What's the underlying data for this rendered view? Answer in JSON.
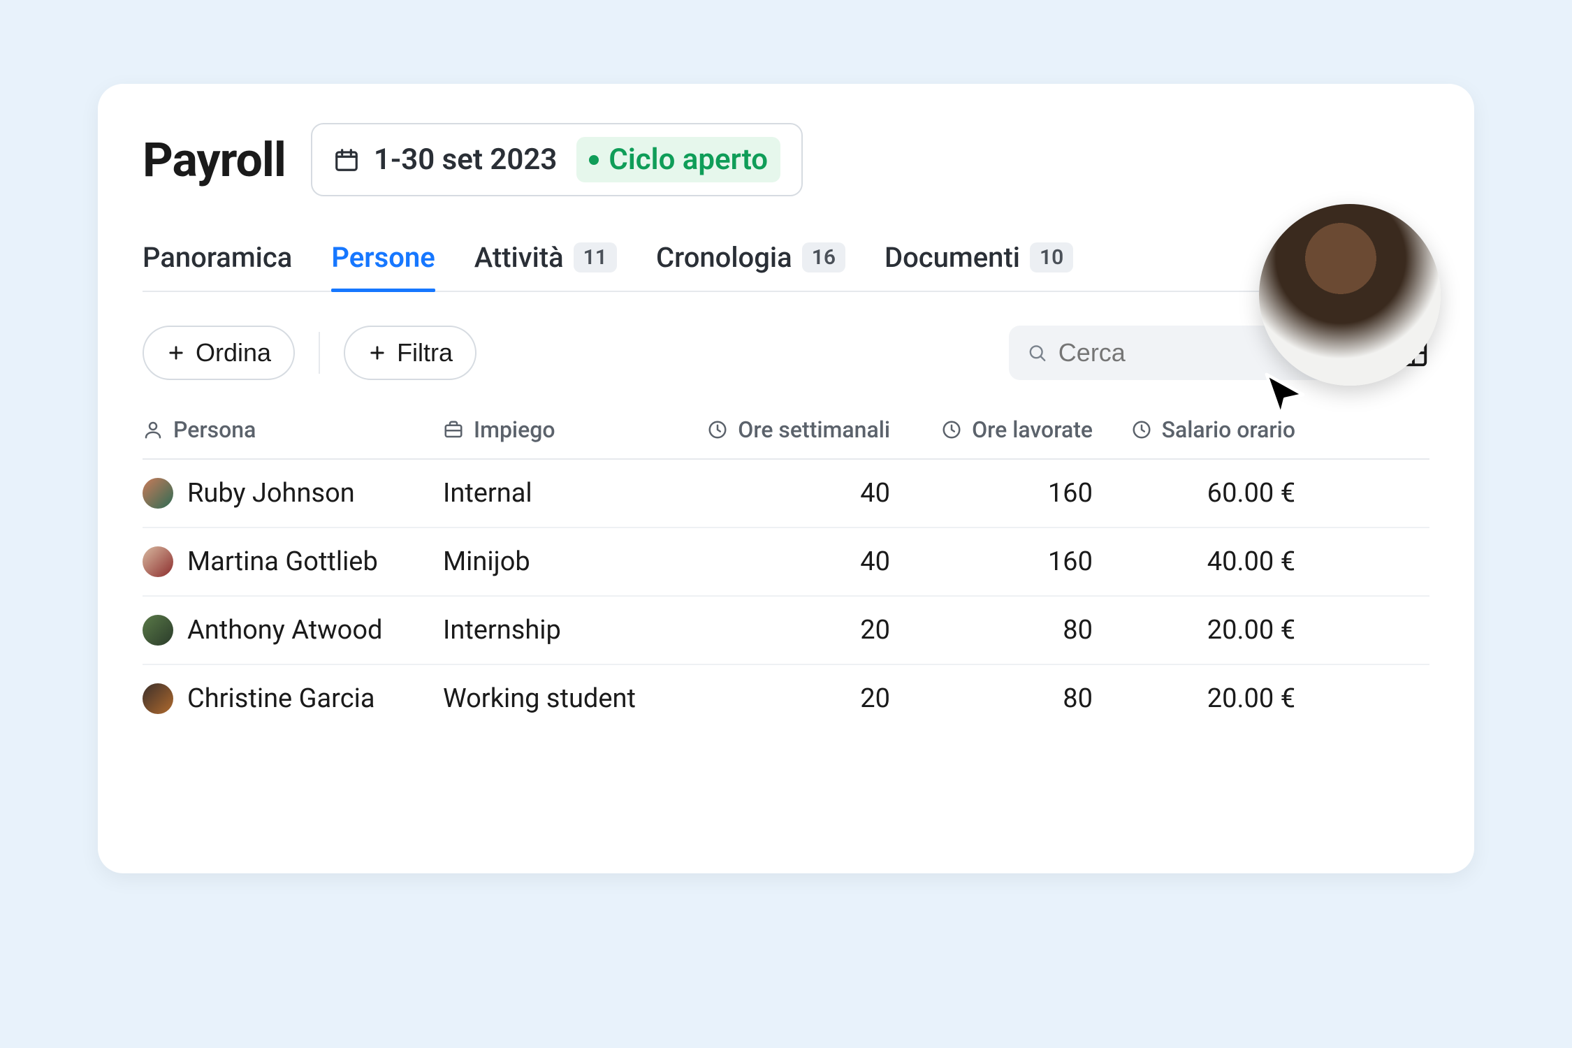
{
  "header": {
    "title": "Payroll",
    "period": "1-30 set 2023",
    "cycle_status": "Ciclo aperto"
  },
  "tabs": [
    {
      "label": "Panoramica",
      "count": null,
      "active": false
    },
    {
      "label": "Persone",
      "count": null,
      "active": true
    },
    {
      "label": "Attività",
      "count": "11",
      "active": false
    },
    {
      "label": "Cronologia",
      "count": "16",
      "active": false
    },
    {
      "label": "Documenti",
      "count": "10",
      "active": false
    }
  ],
  "toolbar": {
    "sort_label": "Ordina",
    "filter_label": "Filtra",
    "search_placeholder": "Cerca"
  },
  "table": {
    "columns": {
      "person": "Persona",
      "employment": "Impiego",
      "weekly_hours": "Ore settimanali",
      "worked_hours": "Ore lavorate",
      "hourly_wage": "Salario orario"
    },
    "rows": [
      {
        "name": "Ruby Johnson",
        "employment": "Internal",
        "weekly_hours": "40",
        "worked_hours": "160",
        "hourly_wage": "60.00 €"
      },
      {
        "name": "Martina Gottlieb",
        "employment": "Minijob",
        "weekly_hours": "40",
        "worked_hours": "160",
        "hourly_wage": "40.00 €"
      },
      {
        "name": "Anthony Atwood",
        "employment": "Internship",
        "weekly_hours": "20",
        "worked_hours": "80",
        "hourly_wage": "20.00 €"
      },
      {
        "name": "Christine Garcia",
        "employment": "Working student",
        "weekly_hours": "20",
        "worked_hours": "80",
        "hourly_wage": "20.00 €"
      }
    ]
  }
}
